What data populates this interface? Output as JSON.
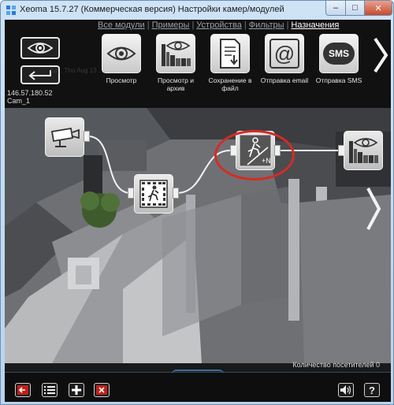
{
  "window": {
    "title": "Xeoma 15.7.27 (Коммерческая версия) Настройки камер/модулей",
    "min_glyph": "–",
    "max_glyph": "□",
    "close_glyph": "✕"
  },
  "tabs": [
    {
      "label": "Все модули",
      "active": false
    },
    {
      "label": "Примеры",
      "active": false
    },
    {
      "label": "Устройства",
      "active": false
    },
    {
      "label": "Фильтры",
      "active": false
    },
    {
      "label": "Назначения",
      "active": true
    }
  ],
  "tab_separator": "|",
  "camera": {
    "ip": "146.57.180.52",
    "name": "Cam_1",
    "overlay_text": "Lo... Thu Aug 13 ..."
  },
  "modules": [
    {
      "label": "Просмотр",
      "icon": "eye-icon"
    },
    {
      "label": "Просмотр и архив",
      "icon": "eye-archive-icon"
    },
    {
      "label": "Сохранение в файл",
      "icon": "save-file-icon"
    },
    {
      "label": "Отправка email",
      "icon": "email-icon",
      "glyph": "@"
    },
    {
      "label": "Отправка SMS",
      "icon": "sms-icon",
      "glyph": "SMS"
    }
  ],
  "chain": {
    "nodes": [
      "camera-source-icon",
      "motion-detector-icon",
      "visitors-counter-icon",
      "preview-archive-icon"
    ],
    "highlighted_node": "visitors-counter-icon",
    "counter_glyph": "+N",
    "highlight_color": "#d62b25"
  },
  "status": {
    "visitors": "Количество посетителей 0"
  },
  "bottom_buttons": [
    {
      "name": "back-button",
      "icon": "exit-icon"
    },
    {
      "name": "list-button",
      "icon": "list-icon"
    },
    {
      "name": "add-button",
      "icon": "plus-icon"
    },
    {
      "name": "delete-button",
      "icon": "delete-icon"
    },
    {
      "name": "sound-button",
      "icon": "speaker-icon"
    },
    {
      "name": "help-button",
      "icon": "help-icon",
      "glyph": "?"
    }
  ],
  "colors": {
    "accent_red": "#d62b25",
    "tab_active": "#ffffff",
    "tab_inactive": "#9aa0a6",
    "title_blue": "#b8d3ee"
  }
}
